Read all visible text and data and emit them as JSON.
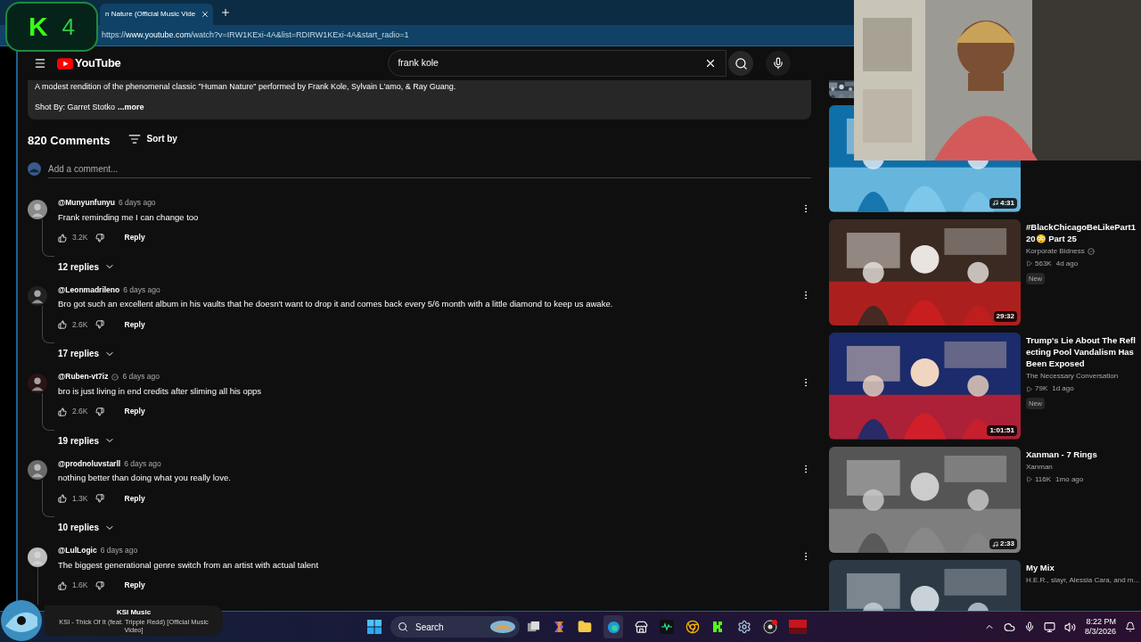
{
  "overlay": {
    "logo_letter": "K",
    "logo_number": "4"
  },
  "browser": {
    "tab_title": "n Nature (Official Music Vide",
    "url_prefix": "https://",
    "url_host": "www.youtube.com",
    "url_path": "/watch?v=IRW1KExi-4A&list=RDIRW1KExi-4A&start_radio=1"
  },
  "youtube": {
    "logo_text": "YouTube",
    "search_value": "frank kole"
  },
  "description": {
    "text": "A modest rendition of the phenomenal classic \"Human Nature\" performed by Frank Kole, Sylvain L'amo, & Ray Guang.",
    "shot_by": "Shot By: Garret Stotko",
    "more": "...more"
  },
  "comments_header": {
    "count": "820 Comments",
    "sort": "Sort by"
  },
  "add_comment": {
    "placeholder": "Add a comment..."
  },
  "comments": [
    {
      "author": "@Munyunfunyu",
      "verified": false,
      "time": "6 days ago",
      "text": "Frank reminding me I can change too",
      "likes": "3.2K",
      "reply": "Reply",
      "replies": "12 replies"
    },
    {
      "author": "@Leonmadrileno",
      "verified": false,
      "time": "6 days ago",
      "text": "Bro got such an excellent album in his vaults that he doesn't want to drop it and comes back every 5/6 month with a little diamond to keep us awake.",
      "likes": "2.6K",
      "reply": "Reply",
      "replies": "17 replies"
    },
    {
      "author": "@Ruben-vt7iz",
      "verified": true,
      "time": "6 days ago",
      "text": "bro is just living in end credits after sliming all his opps",
      "likes": "2.6K",
      "reply": "Reply",
      "replies": "19 replies"
    },
    {
      "author": "@prodnoluvstarll",
      "verified": false,
      "time": "6 days ago",
      "text": "nothing better than doing what you really love.",
      "likes": "1.3K",
      "reply": "Reply",
      "replies": "10 replies"
    },
    {
      "author": "@LulLogic",
      "verified": false,
      "time": "6 days ago",
      "text": "The biggest generational genre switch from an artist with actual talent",
      "likes": "1.6K",
      "reply": "Reply"
    }
  ],
  "sidebar": [
    {
      "kind": "video",
      "music": true,
      "duration": "4:31"
    },
    {
      "kind": "video",
      "music": false,
      "duration": "29:32",
      "title": "#BlackChicagoBeLikePart120😳 Part 25",
      "channel": "Korporate Bidness",
      "verified": true,
      "views": "563K",
      "age": "4d ago",
      "badge": "New"
    },
    {
      "kind": "video",
      "music": false,
      "duration": "1:01:51",
      "title": "Trump's Lie About The Reflecting Pool Vandalism Has Been Exposed",
      "channel": "The Necessary Conversation",
      "verified": false,
      "views": "79K",
      "age": "1d ago",
      "badge": "New"
    },
    {
      "kind": "video",
      "music": true,
      "duration": "2:33",
      "title": "Xanman - 7 Rings",
      "channel": "Xanman",
      "verified": false,
      "views": "116K",
      "age": "1mo ago"
    },
    {
      "kind": "mix",
      "title": "My Mix",
      "channel": "H.E.R., slayr, Alessia Cara, and m..."
    }
  ],
  "now_playing": {
    "channel": "KSI Music",
    "title": "KSI - Thick Of It (feat. Trippie Redd) [Official Music Video]"
  },
  "taskbar": {
    "search": "Search",
    "time": "8:22 PM",
    "date": "8/3/2026"
  }
}
